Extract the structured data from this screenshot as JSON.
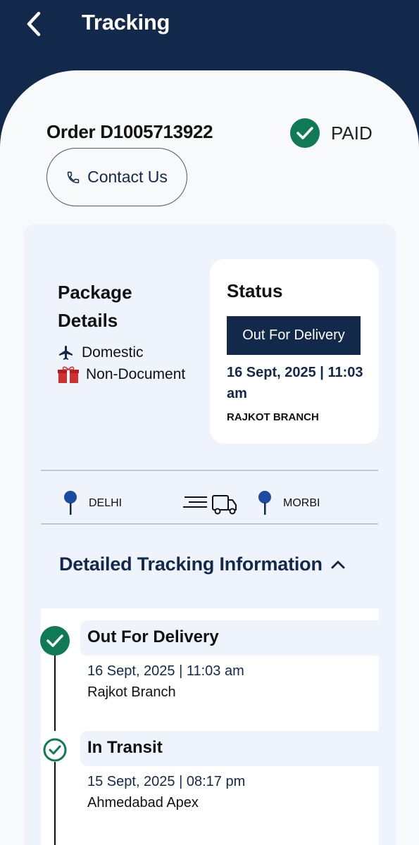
{
  "header": {
    "title": "Tracking",
    "back_icon": "chevron-left-icon"
  },
  "order": {
    "title": "Order D1005713922",
    "payment_status": "PAID",
    "payment_icon": "check-circle-icon",
    "contact_label": "Contact Us",
    "contact_icon": "phone-icon"
  },
  "package": {
    "title": "Package Details",
    "type": "Domestic",
    "type_icon": "airplane-icon",
    "content": "Non-Document",
    "content_icon": "gift-box-icon"
  },
  "status": {
    "title": "Status",
    "badge": "Out For Delivery",
    "datetime": "16 Sept, 2025 | 11:03 am",
    "branch": "RAJKOT BRANCH"
  },
  "route": {
    "origin": "DELHI",
    "destination": "MORBI",
    "pin_icon": "map-pin-icon",
    "truck_icon": "delivery-truck-icon"
  },
  "tracking": {
    "section_title": "Detailed Tracking Information",
    "toggle_icon": "chevron-up-icon",
    "events": [
      {
        "title": "Out For Delivery",
        "datetime": "16 Sept, 2025 | 11:03 am",
        "location": "Rajkot Branch"
      },
      {
        "title": "In Transit",
        "datetime": "15 Sept, 2025 | 08:17 pm",
        "location": "Ahmedabad Apex"
      }
    ]
  },
  "colors": {
    "navy": "#13294b",
    "success_green": "#0f7a55",
    "card_bg": "#eef3fc",
    "gift_red": "#d32f2f"
  }
}
